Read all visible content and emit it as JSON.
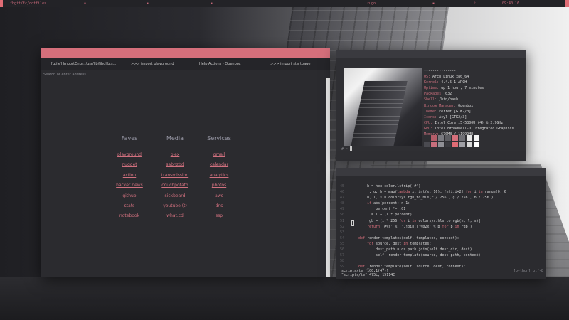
{
  "topbar": {
    "left_label": "fbgit/fc/dotfiles",
    "workspace_label": "rugo",
    "time_label": "09:40:16",
    "accent_color": "#e06c75"
  },
  "browser": {
    "tabs": [
      {
        "label": "[qtile] ImportError: /usr/lib/libglib.s..."
      },
      {
        "label": ">>> import playground"
      },
      {
        "label": "Help Actions - Openbox"
      },
      {
        "label": ">>> import startpage"
      }
    ],
    "address_placeholder": "Search or enter address",
    "columns": [
      {
        "heading": "Faves",
        "links": [
          "playground",
          "nugget",
          "action",
          "hacker news",
          "github",
          "stats",
          "notebook"
        ]
      },
      {
        "heading": "Media",
        "links": [
          "plex",
          "sabnzbd",
          "transmission",
          "couchpotato",
          "sickbeard",
          "youtube (t)",
          "what.cd"
        ]
      },
      {
        "heading": "Services",
        "links": [
          "gmail",
          "calendar",
          "analytics",
          "photos",
          "aws",
          "dns",
          "ssp"
        ]
      }
    ],
    "titlebar_color": "#d56f7b",
    "link_color": "#d0707e"
  },
  "terminal_info": {
    "separator": "---------------",
    "rows": [
      {
        "key": "OS:",
        "value": "Arch Linux x86_64"
      },
      {
        "key": "Kernel:",
        "value": "4.4.5-1-ARCH"
      },
      {
        "key": "Uptime:",
        "value": "up 1 hour, 7 minutes"
      },
      {
        "key": "Packages:",
        "value": "632"
      },
      {
        "key": "Shell:",
        "value": "/bin/bash"
      },
      {
        "key": "Window Manager:",
        "value": "Openbox"
      },
      {
        "key": "Theme:",
        "value": "Ferret [GTK2/3]"
      },
      {
        "key": "Icons:",
        "value": "Acyl [GTK2/3]"
      },
      {
        "key": "CPU:",
        "value": "Intel Core i5-5300U (4) @ 2.9GHz"
      },
      {
        "key": "GPU:",
        "value": "Intel Broadwell-U Integrated Graphics"
      },
      {
        "key": "Memory:",
        "value": "670MB / 11999MB"
      }
    ],
    "prompt": "# ~",
    "swatch_colors": [
      "#2f2f33",
      "#b55d69",
      "#7a7a80",
      "#5d5d62",
      "#d56f7b",
      "#6f6f75",
      "#e8e8e8",
      "#f5f5f5",
      "#4a4a50",
      "#c86e7c",
      "#909096",
      "#3a3a3f",
      "#e06c75",
      "#a0a0a6",
      "#d8d8d8",
      "#ffffff"
    ]
  },
  "editor": {
    "lines": [
      {
        "n": "45",
        "text": "        h = hex_color.lstrip('#')"
      },
      {
        "n": "46",
        "text": "        r, g, b = map(lambda x: int(x, 16), [h[i:i+2] for i in range(0, 6"
      },
      {
        "n": "47",
        "text": "        h, l, s = colorsys.rgb_to_hls(r / 256., g / 256., b / 256.)"
      },
      {
        "n": "48",
        "text": "        if abs(percent) > 1:"
      },
      {
        "n": "49",
        "text": "            percent *= .01"
      },
      {
        "n": "50",
        "text": "        l = l + (l * percent)"
      },
      {
        "n": "51",
        "text": "        rgb = [i * 256 for i in colorsys.hls_to_rgb(h, l, s)]"
      },
      {
        "n": "52",
        "text": "        return '#%s' % ''.join(['%02x' % p for p in rgb])"
      },
      {
        "n": "53",
        "text": ""
      },
      {
        "n": "54",
        "text": "    def render_templates(self, templates, context):"
      },
      {
        "n": "55",
        "text": "        for source, dest in templates:"
      },
      {
        "n": "56",
        "text": "            dest_path = os.path.join(self.dest_dir, dest)"
      },
      {
        "n": "57",
        "text": "            self._render_template(source, dest_path, context)"
      },
      {
        "n": "58",
        "text": ""
      },
      {
        "n": "59",
        "text": "    def _render_template(self, source, dest, context):"
      }
    ],
    "file_line": "scripts/te [100,1(47)]",
    "mode_label": "[python] utf-8",
    "status": "\"scripts/te\" 475L, 15114C"
  }
}
